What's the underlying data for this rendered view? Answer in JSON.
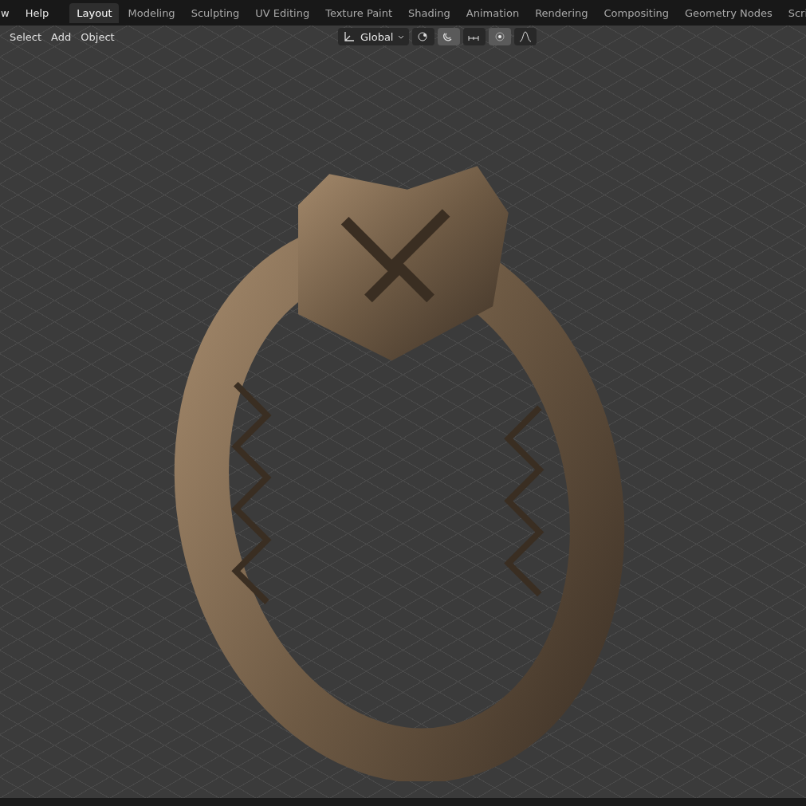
{
  "top_menu": [
    "w",
    "Help"
  ],
  "workspace_tabs": [
    {
      "label": "Layout",
      "selected": true
    },
    {
      "label": "Modeling",
      "selected": false
    },
    {
      "label": "Sculpting",
      "selected": false
    },
    {
      "label": "UV Editing",
      "selected": false
    },
    {
      "label": "Texture Paint",
      "selected": false
    },
    {
      "label": "Shading",
      "selected": false
    },
    {
      "label": "Animation",
      "selected": false
    },
    {
      "label": "Rendering",
      "selected": false
    },
    {
      "label": "Compositing",
      "selected": false
    },
    {
      "label": "Geometry Nodes",
      "selected": false
    },
    {
      "label": "Scri",
      "selected": false
    }
  ],
  "viewport_menu": [
    "Select",
    "Add",
    "Object"
  ],
  "transform_orientation": {
    "value": "Global"
  },
  "tools": [
    {
      "kind": "pivot",
      "on": false
    },
    {
      "kind": "snap",
      "on": true
    },
    {
      "kind": "increment",
      "on": false
    },
    {
      "kind": "proportional",
      "on": true
    },
    {
      "kind": "falloff",
      "on": false
    }
  ]
}
